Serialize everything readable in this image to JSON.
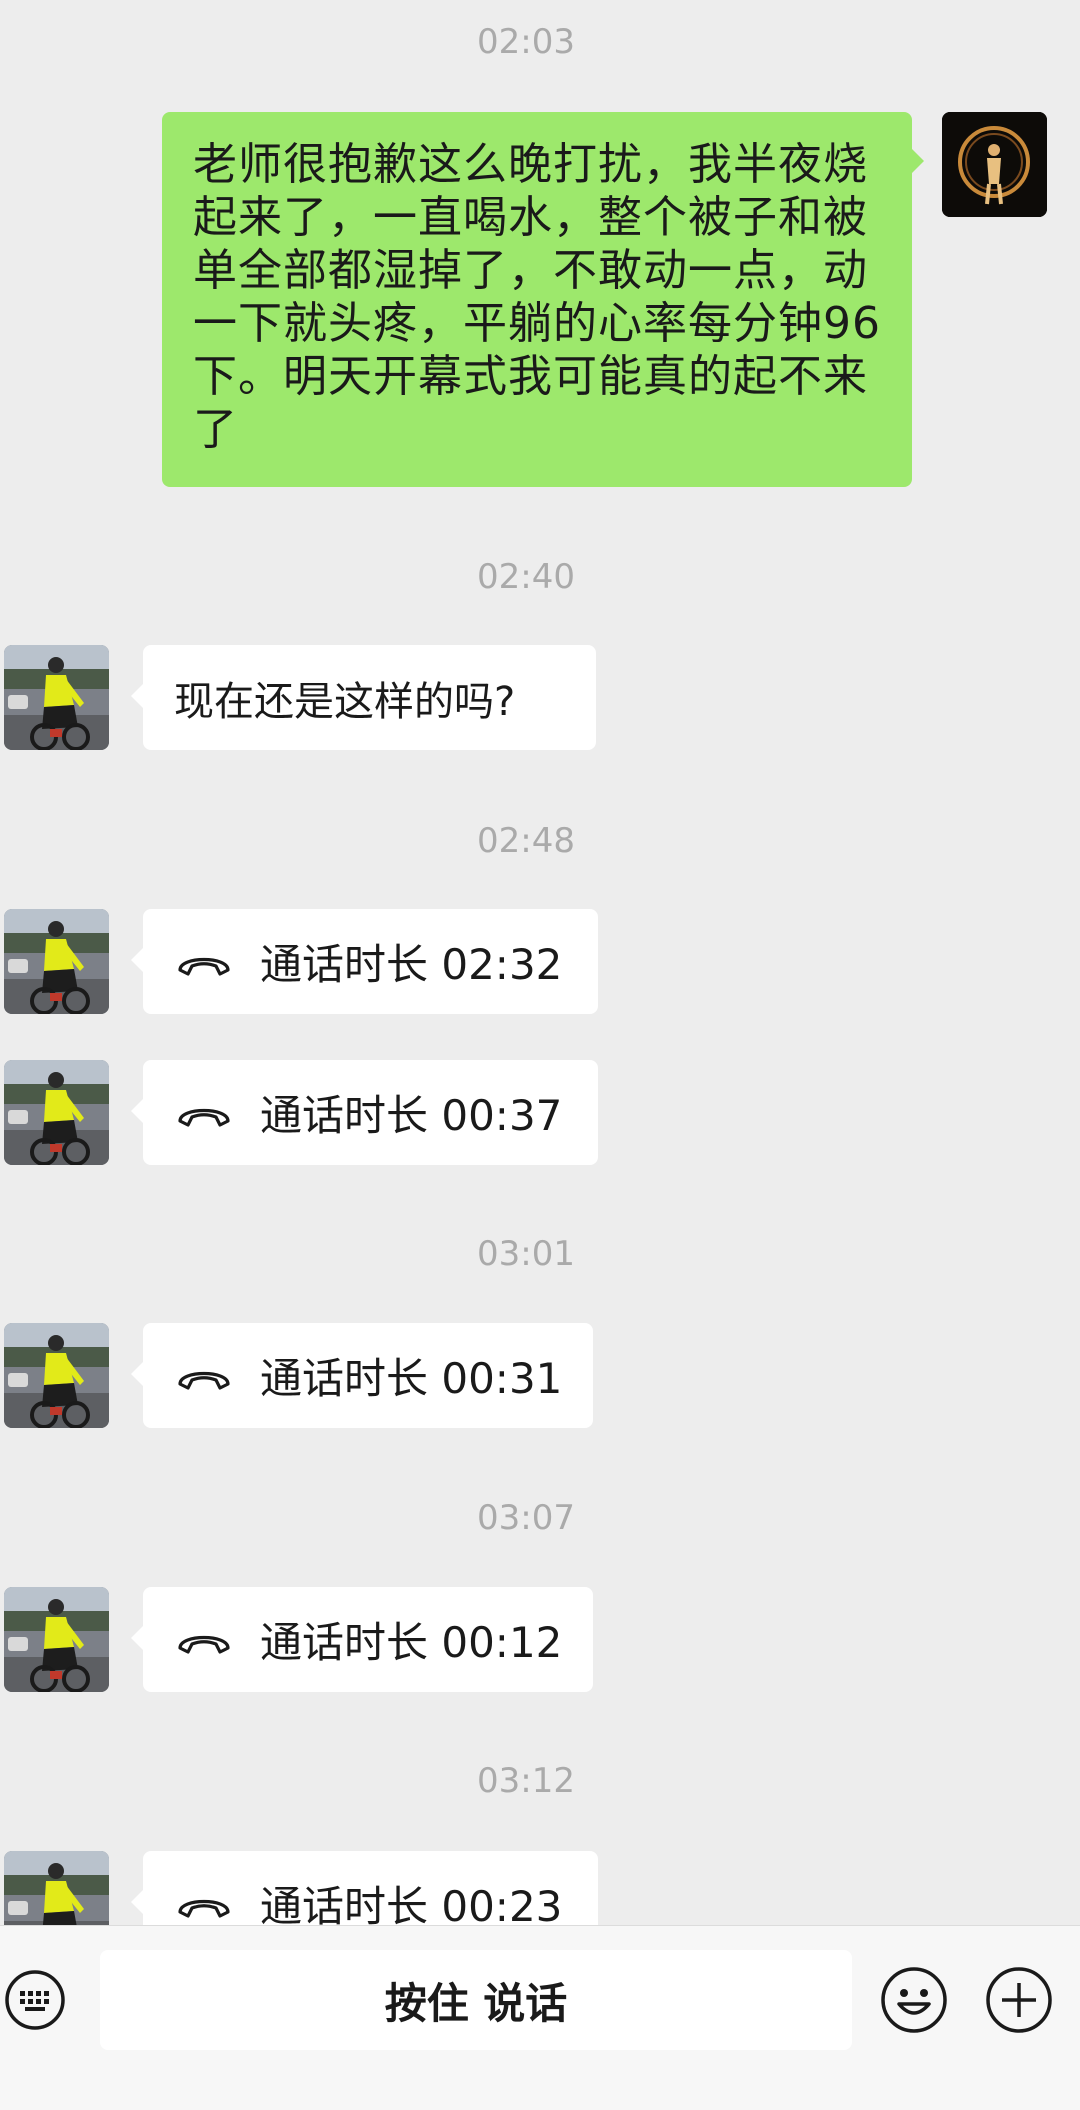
{
  "timestamps": [
    "02:03",
    "02:40",
    "02:48",
    "03:01",
    "03:07",
    "03:12"
  ],
  "outgoing_message": "老师很抱歉这么晚打扰，我半夜烧起来了，一直喝水，整个被子和被单全部都湿掉了，不敢动一点，动一下就头疼，平躺的心率每分钟96下。明天开幕式我可能真的起不来了",
  "incoming_message": "现在还是这样的吗?",
  "calls": [
    {
      "label": "通话时长 02:32"
    },
    {
      "label": "通话时长 00:37"
    },
    {
      "label": "通话时长 00:31"
    },
    {
      "label": "通话时长 00:12"
    },
    {
      "label": "通话时长 00:23"
    }
  ],
  "input_bar": {
    "voice_button_label": "按住 说话",
    "keyboard_icon": "keyboard-icon",
    "emoji_icon": "emoji-icon",
    "plus_icon": "plus-icon"
  },
  "colors": {
    "background": "#ededed",
    "outgoing_bubble": "#9de86c",
    "incoming_bubble": "#ffffff"
  }
}
